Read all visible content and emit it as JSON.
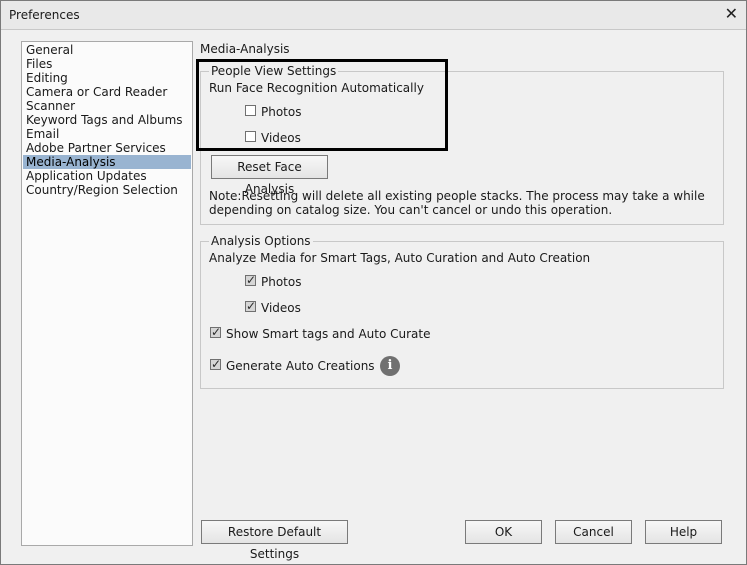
{
  "window": {
    "title": "Preferences"
  },
  "sidebar": {
    "items": [
      {
        "label": "General"
      },
      {
        "label": "Files"
      },
      {
        "label": "Editing"
      },
      {
        "label": "Camera or Card Reader"
      },
      {
        "label": "Scanner"
      },
      {
        "label": "Keyword Tags and Albums"
      },
      {
        "label": "Email"
      },
      {
        "label": "Adobe Partner Services"
      },
      {
        "label": "Media-Analysis"
      },
      {
        "label": "Application Updates"
      },
      {
        "label": "Country/Region Selection"
      }
    ],
    "selected": "Media-Analysis"
  },
  "main": {
    "section_title": "Media-Analysis",
    "people_view": {
      "legend": "People View Settings",
      "heading": "Run Face Recognition Automatically",
      "photos": {
        "label": "Photos",
        "checked": false
      },
      "videos": {
        "label": "Videos",
        "checked": false
      },
      "reset_button": "Reset Face Analysis",
      "note_line1": "Note:Resetting will delete all existing people stacks. The process may take a while",
      "note_line2": "depending on catalog size. You can't cancel or undo this operation."
    },
    "analysis": {
      "legend": "Analysis Options",
      "heading": "Analyze Media for Smart Tags, Auto Curation and Auto Creation",
      "photos": {
        "label": "Photos",
        "checked": true
      },
      "videos": {
        "label": "Videos",
        "checked": true
      },
      "smart_tags": {
        "label": "Show Smart tags and Auto Curate",
        "checked": true
      },
      "auto_creations": {
        "label": "Generate Auto Creations",
        "checked": true
      },
      "info_icon": "info-icon"
    }
  },
  "footer": {
    "restore": "Restore Default Settings",
    "ok": "OK",
    "cancel": "Cancel",
    "help": "Help"
  },
  "colors": {
    "selection": "#99b4d1",
    "highlight_border": "#000000"
  }
}
